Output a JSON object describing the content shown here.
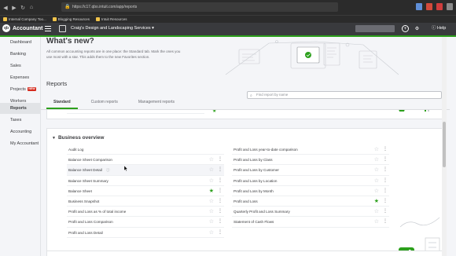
{
  "browser": {
    "url": "https://c17.qbo.intuit.com/app/reports",
    "bookmarks": [
      "Internal Company Too...",
      "Blogging Resources",
      "Intuit Resources"
    ]
  },
  "header": {
    "brand": "Accountant",
    "logo_text": "qb",
    "company": "Craig's Design and Landscaping Services",
    "help": "Help"
  },
  "sidebar": {
    "items": [
      {
        "label": "Dashboard"
      },
      {
        "label": "Banking"
      },
      {
        "label": "Sales"
      },
      {
        "label": "Expenses"
      },
      {
        "label": "Projects",
        "badge": "NEW"
      },
      {
        "label": "Workers"
      },
      {
        "label": "Reports",
        "active": true
      },
      {
        "label": "Taxes"
      },
      {
        "label": "Accounting"
      },
      {
        "label": "My Accountant"
      }
    ]
  },
  "main": {
    "whats_new": "What's new?",
    "intro": "All common accounting reports are in one place: the Standard tab. Mark the ones you use most with a star. This adds them to the new Favorites section.",
    "reports_title": "Reports",
    "search_placeholder": "Find report by name",
    "tabs": [
      "Standard",
      "Custom reports",
      "Management reports"
    ],
    "section_title": "Business overview",
    "left_reports": [
      {
        "label": "Audit Log",
        "star": false,
        "fav": false
      },
      {
        "label": "Balance Sheet Comparison",
        "star": true,
        "fav": false
      },
      {
        "label": "Balance Sheet Detail",
        "star": true,
        "fav": false,
        "highlight": true,
        "info": "ⓘ"
      },
      {
        "label": "Balance Sheet Summary",
        "star": true,
        "fav": false
      },
      {
        "label": "Balance Sheet",
        "star": true,
        "fav": true
      },
      {
        "label": "Business Snapshot",
        "star": true,
        "fav": false
      },
      {
        "label": "Profit and Loss as % of total income",
        "star": true,
        "fav": false
      },
      {
        "label": "Profit and Loss Comparison",
        "star": true,
        "fav": false
      },
      {
        "label": "Profit and Loss Detail",
        "star": true,
        "fav": false
      }
    ],
    "right_reports": [
      {
        "label": "Profit and Loss year-to-date comparison",
        "star": true,
        "fav": false
      },
      {
        "label": "Profit and Loss by Class",
        "star": true,
        "fav": false
      },
      {
        "label": "Profit and Loss by Customer",
        "star": true,
        "fav": false
      },
      {
        "label": "Profit and Loss by Location",
        "star": true,
        "fav": false
      },
      {
        "label": "Profit and Loss by Month",
        "star": true,
        "fav": false
      },
      {
        "label": "Profit and Loss",
        "star": true,
        "fav": true
      },
      {
        "label": "Quarterly Profit and Loss Summary",
        "star": true,
        "fav": false
      },
      {
        "label": "Statement of Cash Flows",
        "star": true,
        "fav": false
      }
    ]
  },
  "colors": {
    "accent": "#2ca01c",
    "header": "#393a3d",
    "badge": "#d52b1e"
  }
}
